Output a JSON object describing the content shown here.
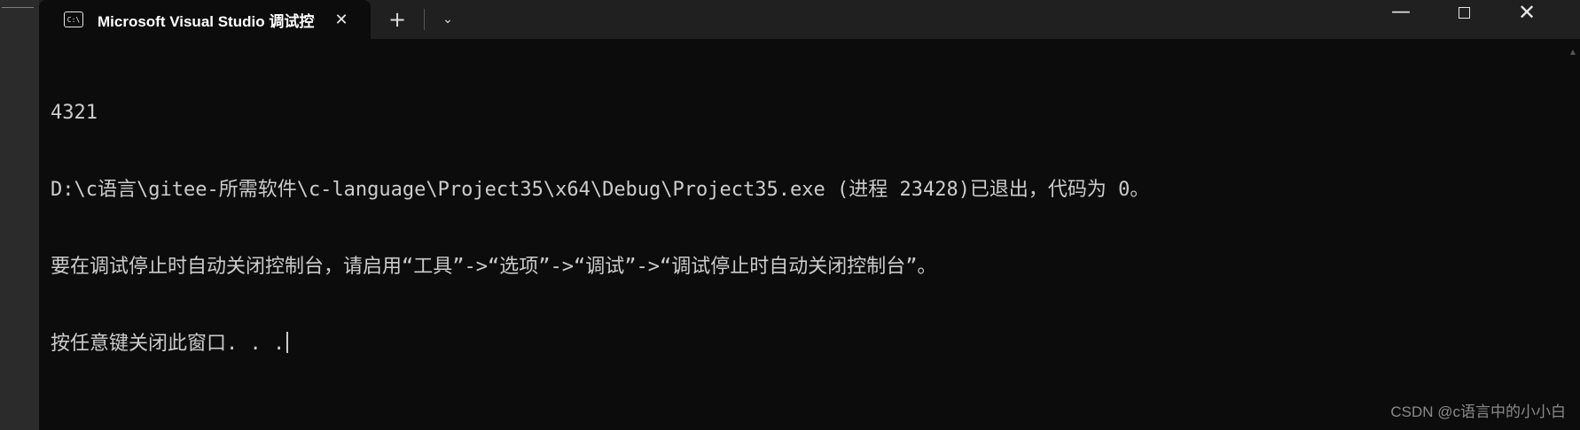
{
  "window": {
    "tab_title": "Microsoft Visual Studio 调试控制台",
    "tab_icon_text": "C:\\",
    "tab_close_glyph": "✕",
    "new_tab_glyph": "+",
    "dropdown_glyph": "⌄",
    "minimize_glyph": "—",
    "close_glyph": "✕"
  },
  "console": {
    "lines": [
      "4321",
      "D:\\c语言\\gitee-所需软件\\c-language\\Project35\\x64\\Debug\\Project35.exe (进程 23428)已退出，代码为 0。",
      "要在调试停止时自动关闭控制台，请启用“工具”->“选项”->“调试”->“调试停止时自动关闭控制台”。",
      "按任意键关闭此窗口. . ."
    ]
  },
  "watermark": "CSDN @c语言中的小小白",
  "colors": {
    "console_bg": "#0c0c0c",
    "titlebar_bg": "#202020",
    "console_text": "#cccccc"
  },
  "icons": {
    "tab": "terminal-icon",
    "close": "close-icon",
    "add": "plus-icon",
    "dropdown": "chevron-down-icon",
    "minimize": "minimize-icon",
    "maximize": "maximize-icon"
  }
}
